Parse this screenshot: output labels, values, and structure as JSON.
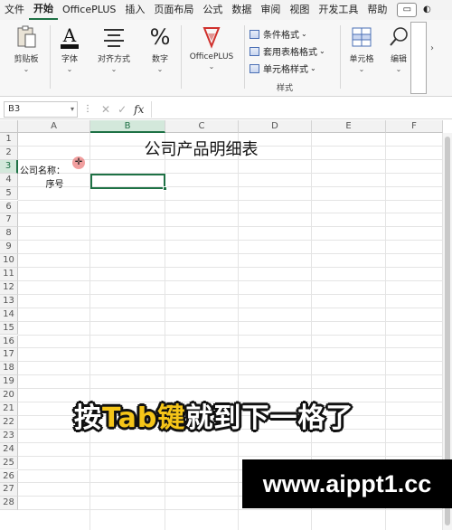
{
  "menu": {
    "items": [
      "文件",
      "开始",
      "OfficePLUS",
      "插入",
      "页面布局",
      "公式",
      "数据",
      "审阅",
      "视图",
      "开发工具",
      "帮助"
    ],
    "active_index": 1
  },
  "ribbon": {
    "clipboard_label": "剪贴板",
    "font_label": "字体",
    "align_label": "对齐方式",
    "number_label": "数字",
    "officeplus_label": "OfficePLUS",
    "cond_format_label": "条件格式",
    "table_format_label": "套用表格格式",
    "cell_style_label": "单元格样式",
    "styles_group_label": "样式",
    "cells_label": "单元格",
    "edit_label": "编辑",
    "chevron": "⌄"
  },
  "formula_bar": {
    "name_box": "B3",
    "fx": "fx",
    "value": ""
  },
  "sheet": {
    "columns": [
      "A",
      "B",
      "C",
      "D",
      "E",
      "F"
    ],
    "selected_column_index": 1,
    "rows": [
      "1",
      "2",
      "3",
      "4",
      "5",
      "6",
      "7",
      "8",
      "9",
      "10",
      "11",
      "12",
      "13",
      "14",
      "15",
      "16",
      "17",
      "18",
      "19",
      "20",
      "21",
      "22",
      "23",
      "24",
      "25",
      "26",
      "27",
      "28"
    ],
    "selected_row_index": 2,
    "title": "公司产品明细表",
    "a2": "公司名称：",
    "a3": "序号"
  },
  "overlay": {
    "subtitle_parts": [
      {
        "text": "按",
        "style": "w"
      },
      {
        "text": "Tab",
        "style": "y"
      },
      {
        "text": "键",
        "style": "y"
      },
      {
        "text": "就到下一格了",
        "style": "w"
      }
    ],
    "watermark": "www.aippt1.cc"
  },
  "colors": {
    "accent": "#1e7145",
    "subtitle_highlight": "#f5c518"
  }
}
